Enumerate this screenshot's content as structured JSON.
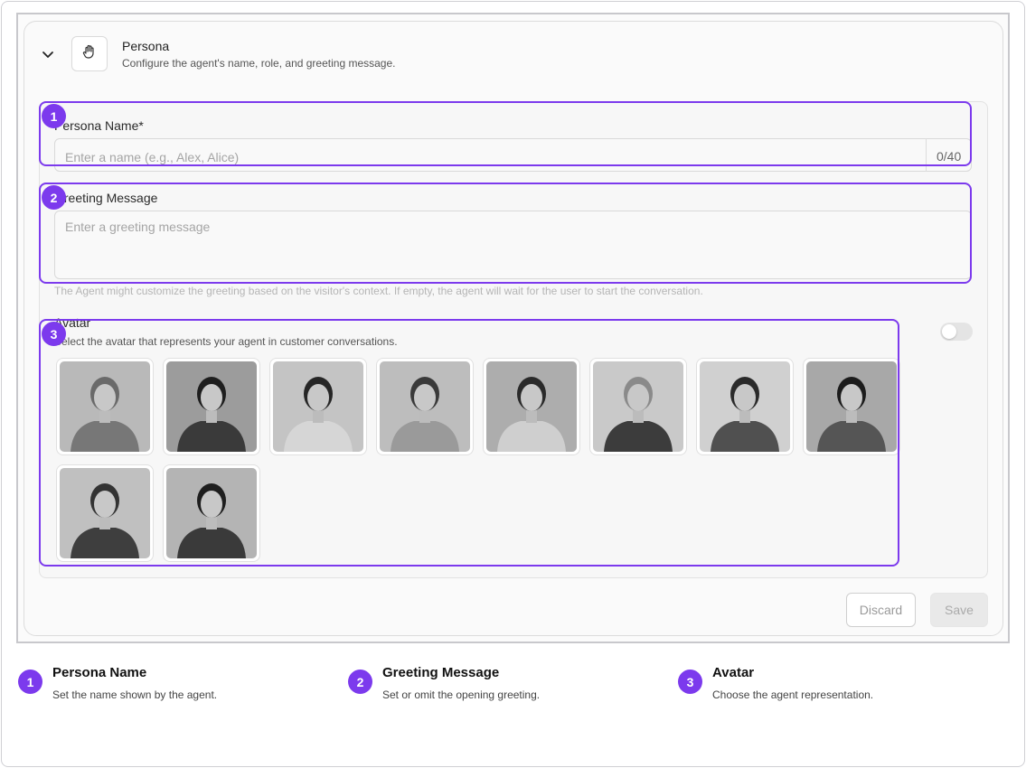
{
  "persona": {
    "title": "Persona",
    "subtitle": "Configure the agent's name, role, and greeting message.",
    "name_label": "Persona Name*",
    "name_placeholder": "Enter a name (e.g., Alex, Alice)",
    "name_counter": "0/40",
    "greeting_label": "Greeting Message",
    "greeting_placeholder": "Enter a greeting message",
    "greeting_hint": "The Agent might customize the greeting based on the visitor's context. If empty, the agent will wait for the user to start the conversation.",
    "avatar_label": "Avatar",
    "avatar_subtitle": "Select the avatar that represents your agent in customer conversations.",
    "avatar_toggle_on": false
  },
  "buttons": {
    "discard": "Discard",
    "save": "Save"
  },
  "callouts": [
    "1",
    "2",
    "3"
  ],
  "legend": [
    {
      "number": "1",
      "title": "Persona Name",
      "description": "Set the name shown by the agent."
    },
    {
      "number": "2",
      "title": "Greeting Message",
      "description": "Set or omit the opening greeting."
    },
    {
      "number": "3",
      "title": "Avatar",
      "description": "Choose the agent representation."
    }
  ],
  "colors": {
    "accent": "#7c3aed"
  },
  "icons": {
    "collapse": "chevron-down-icon",
    "persona": "hand-wave-icon"
  }
}
